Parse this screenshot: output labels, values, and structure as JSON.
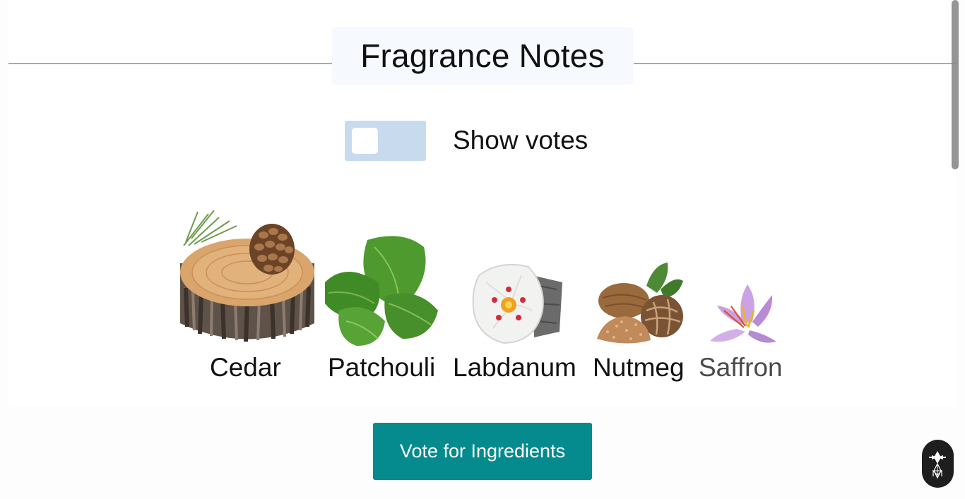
{
  "section": {
    "title": "Fragrance Notes"
  },
  "toggle": {
    "label": "Show votes",
    "checked": false
  },
  "notes": [
    {
      "name": "Cedar",
      "icon": "cedar-wood-icon"
    },
    {
      "name": "Patchouli",
      "icon": "patchouli-leaf-icon"
    },
    {
      "name": "Labdanum",
      "icon": "labdanum-flower-icon"
    },
    {
      "name": "Nutmeg",
      "icon": "nutmeg-icon"
    },
    {
      "name": "Saffron",
      "icon": "saffron-flower-icon"
    }
  ],
  "actions": {
    "vote_label": "Vote for Ingredients"
  },
  "colors": {
    "accent": "#058a8e",
    "toggle_track": "#c8dbee",
    "divider": "#93aec4"
  },
  "widgets": {
    "logo_icon": "brand-logo-icon"
  }
}
